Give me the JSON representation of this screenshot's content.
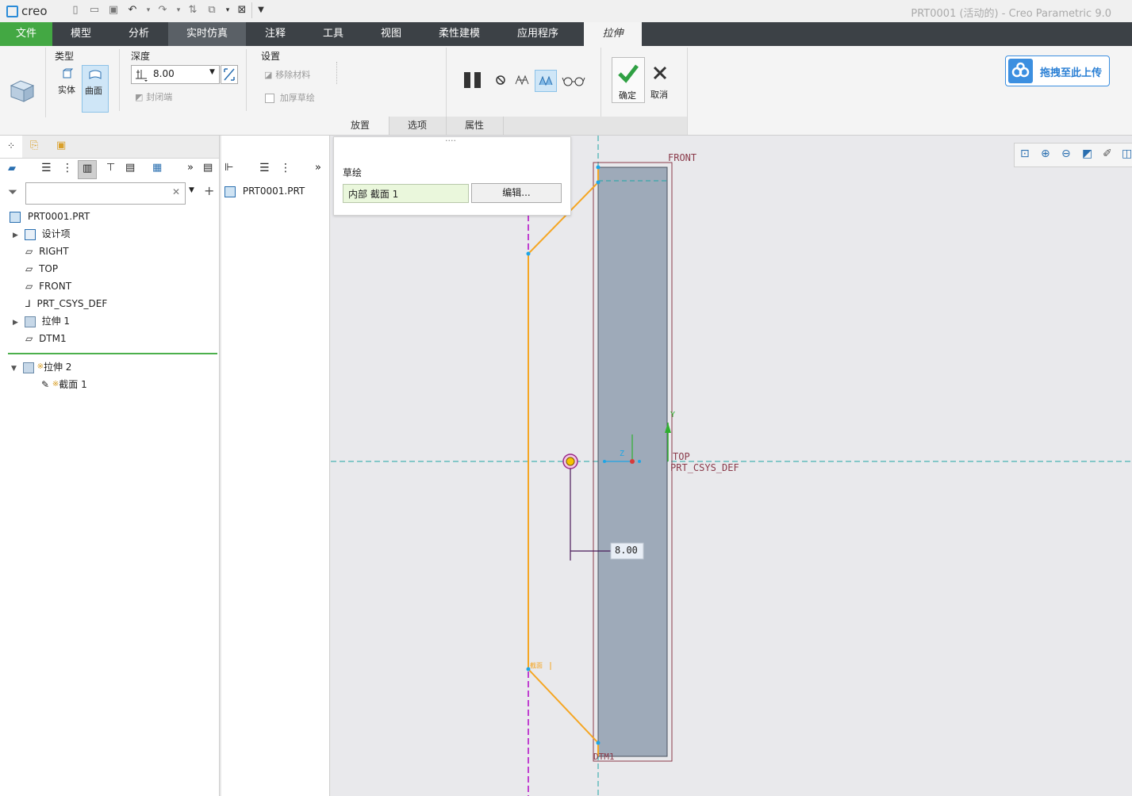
{
  "app": {
    "logo": "creo",
    "window_title": "PRT0001 (活动的) - Creo Parametric 9.0"
  },
  "tabs": [
    "文件",
    "模型",
    "分析",
    "实时仿真",
    "注释",
    "工具",
    "视图",
    "柔性建模",
    "应用程序",
    "拉伸"
  ],
  "ribbon": {
    "type_group": "类型",
    "solid": "实体",
    "surface": "曲面",
    "depth_group": "深度",
    "depth_value": "8.00",
    "close_ends": "封闭端",
    "settings_group": "设置",
    "remove_material": "移除材料",
    "thicken_sketch": "加厚草绘",
    "ok": "确定",
    "cancel": "取消"
  },
  "subtabs": [
    "放置",
    "选项",
    "属性"
  ],
  "placement_panel": {
    "dots": "····",
    "label": "草绘",
    "sketch_value": "内部 截面 1",
    "edit_button": "编辑..."
  },
  "upload_button": "拖拽至此上传",
  "model_tree": {
    "root": "PRT0001.PRT",
    "items": [
      "设计项",
      "RIGHT",
      "TOP",
      "FRONT",
      "PRT_CSYS_DEF",
      "拉伸 1",
      "DTM1"
    ],
    "insert_feature": "拉伸 2",
    "insert_child": "截面 1",
    "new_marker": "※"
  },
  "layer_pane": {
    "root": "PRT0001.PRT"
  },
  "graphics": {
    "front_label": "FRONT",
    "top_label": "TOP",
    "csys_label": "PRT_CSYS_DEF",
    "dtm_label": "DTM1",
    "dimension": "8.00",
    "y_label": "Y",
    "z_label": "Z",
    "section_label": "截面",
    "colors": {
      "accent": "#43a843",
      "orange": "#f5a623",
      "datum": "#1ea5a5",
      "axis": "#c040d0",
      "body": "#9eaab9"
    }
  }
}
